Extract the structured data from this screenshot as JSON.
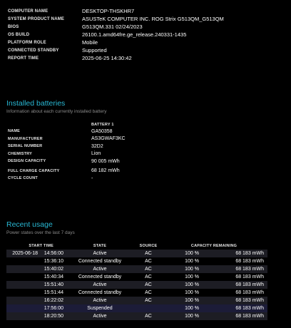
{
  "system_info": [
    {
      "label": "COMPUTER NAME",
      "value": "DESKTOP-THSKHR7"
    },
    {
      "label": "SYSTEM PRODUCT NAME",
      "value": "ASUSTeK COMPUTER INC. ROG Strix G513QM_G513QM"
    },
    {
      "label": "BIOS",
      "value": "G513QM.331 02/24/2023"
    },
    {
      "label": "OS BUILD",
      "value": "26100.1.amd64fre.ge_release.240331-1435"
    },
    {
      "label": "PLATFORM ROLE",
      "value": "Mobile"
    },
    {
      "label": "CONNECTED STANDBY",
      "value": "Supported"
    },
    {
      "label": "REPORT TIME",
      "value": "2025-06-25  14:30:42"
    }
  ],
  "batteries": {
    "title": "Installed batteries",
    "subtitle": "Information about each currently installed battery",
    "column_header": "BATTERY 1",
    "rows": [
      {
        "label": "NAME",
        "value": "GA50358"
      },
      {
        "label": "MANUFACTURER",
        "value": "AS3GWAF3KC"
      },
      {
        "label": "SERIAL NUMBER",
        "value": "32D2"
      },
      {
        "label": "CHEMISTRY",
        "value": "Lion"
      },
      {
        "label": "DESIGN CAPACITY",
        "value": "90 005 mWh"
      },
      {
        "label": "FULL CHARGE CAPACITY",
        "value": "68 182 mWh"
      },
      {
        "label": "CYCLE COUNT",
        "value": "-"
      }
    ]
  },
  "recent_usage": {
    "title": "Recent usage",
    "subtitle": "Power states over the last 7 days",
    "headers": {
      "start_time": "START TIME",
      "state": "STATE",
      "source": "SOURCE",
      "capacity_remaining": "CAPACITY REMAINING"
    },
    "rows": [
      {
        "date": "2025-06-18",
        "time": "14:56:00",
        "state": "Active",
        "source": "AC",
        "percent": "100 %",
        "capacity": "68 183 mWh"
      },
      {
        "date": "",
        "time": "15:36:10",
        "state": "Connected standby",
        "source": "AC",
        "percent": "100 %",
        "capacity": "68 183 mWh"
      },
      {
        "date": "",
        "time": "15:40:02",
        "state": "Active",
        "source": "AC",
        "percent": "100 %",
        "capacity": "68 183 mWh"
      },
      {
        "date": "",
        "time": "15:40:34",
        "state": "Connected standby",
        "source": "AC",
        "percent": "100 %",
        "capacity": "68 183 mWh"
      },
      {
        "date": "",
        "time": "15:51:40",
        "state": "Active",
        "source": "AC",
        "percent": "100 %",
        "capacity": "68 183 mWh"
      },
      {
        "date": "",
        "time": "15:51:44",
        "state": "Connected standby",
        "source": "AC",
        "percent": "100 %",
        "capacity": "68 183 mWh"
      },
      {
        "date": "",
        "time": "16:22:02",
        "state": "Active",
        "source": "AC",
        "percent": "100 %",
        "capacity": "68 183 mWh"
      },
      {
        "date": "",
        "time": "17:56:00",
        "state": "Suspended",
        "source": "",
        "percent": "100 %",
        "capacity": "68 183 mWh"
      },
      {
        "date": "",
        "time": "18:20:50",
        "state": "Active",
        "source": "AC",
        "percent": "100 %",
        "capacity": "68 183 mWh"
      }
    ]
  },
  "colors": {
    "background": "#000000",
    "section_title": "#29b8d4",
    "subtitle": "#8a8a8a",
    "row_stripe": "#1d1d24",
    "row_highlight": "#1c1c38"
  }
}
